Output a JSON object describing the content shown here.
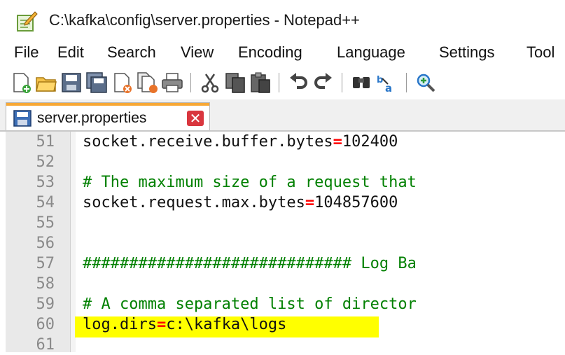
{
  "window": {
    "title": "C:\\kafka\\config\\server.properties - Notepad++"
  },
  "menu": [
    "File",
    "Edit",
    "Search",
    "View",
    "Encoding",
    "Language",
    "Settings",
    "Tool"
  ],
  "toolbar": {
    "buttons": [
      "new-file-icon",
      "open-file-icon",
      "save-icon",
      "save-all-icon",
      "close-icon",
      "close-all-icon",
      "print-icon",
      "cut-icon",
      "copy-icon",
      "paste-icon",
      "undo-icon",
      "redo-icon",
      "find-icon",
      "replace-icon",
      "zoom-in-icon"
    ]
  },
  "tab": {
    "label": "server.properties",
    "close_glyph": "✕"
  },
  "editor": {
    "lines": [
      {
        "n": "51",
        "key": "socket.receive.buffer.bytes",
        "eq": "=",
        "val": "102400"
      },
      {
        "n": "52"
      },
      {
        "n": "53",
        "comment": "# The maximum size of a request that"
      },
      {
        "n": "54",
        "key": "socket.request.max.bytes",
        "eq": "=",
        "val": "104857600"
      },
      {
        "n": "55"
      },
      {
        "n": "56"
      },
      {
        "n": "57",
        "comment": "############################# Log Ba"
      },
      {
        "n": "58"
      },
      {
        "n": "59",
        "comment": "# A comma separated list of director"
      },
      {
        "n": "60",
        "key": "log.dirs",
        "eq": "=",
        "val": "c:\\kafka\\logs",
        "highlight": "#ffff00"
      },
      {
        "n": "61"
      }
    ]
  },
  "colors": {
    "comment": "#008000",
    "operator": "#ff0000",
    "highlight": "#ffff00",
    "tab_accent": "#f7a836"
  }
}
